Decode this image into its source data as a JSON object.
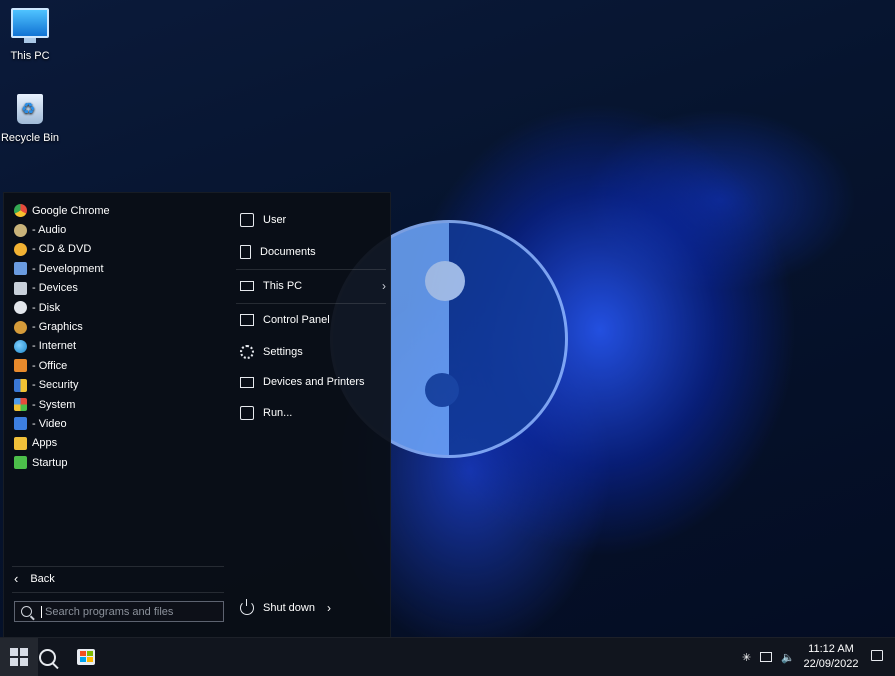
{
  "desktop": {
    "icons": [
      {
        "label": "This PC",
        "icon": "monitor-icon"
      },
      {
        "label": "Recycle Bin",
        "icon": "recycle-bin-icon"
      }
    ]
  },
  "start_menu": {
    "programs": [
      {
        "label": "Google Chrome",
        "icon": "chrome-icon",
        "color": "#e64a3b"
      },
      {
        "label": "- Audio",
        "icon": "audio-icon",
        "color": "#c9b37a"
      },
      {
        "label": "- CD & DVD",
        "icon": "cd-dvd-icon",
        "color": "#f2b233"
      },
      {
        "label": "- Development",
        "icon": "development-icon",
        "color": "#6a9be0"
      },
      {
        "label": "- Devices",
        "icon": "devices-icon",
        "color": "#c8d0da"
      },
      {
        "label": "- Disk",
        "icon": "disk-icon",
        "color": "#e2e6ec"
      },
      {
        "label": "- Graphics",
        "icon": "graphics-icon",
        "color": "#d59b3a"
      },
      {
        "label": "- Internet",
        "icon": "internet-icon",
        "color": "#2fa3e0"
      },
      {
        "label": "- Office",
        "icon": "office-icon",
        "color": "#e88a2c"
      },
      {
        "label": "- Security",
        "icon": "security-icon",
        "color": "#3a78d6"
      },
      {
        "label": "- System",
        "icon": "system-icon",
        "color": "#4f9be8"
      },
      {
        "label": "- Video",
        "icon": "video-icon",
        "color": "#3d7fe0"
      },
      {
        "label": "Apps",
        "icon": "apps-icon",
        "color": "#f0c03a"
      },
      {
        "label": "Startup",
        "icon": "startup-icon",
        "color": "#4cbf4a"
      }
    ],
    "back_label": "Back",
    "search_placeholder": "Search programs and files",
    "places": [
      {
        "label": "User",
        "icon": "user-icon"
      },
      {
        "label": "Documents",
        "icon": "document-icon"
      },
      {
        "label": "This PC",
        "icon": "this-pc-icon",
        "has_submenu": true
      },
      {
        "label": "Control Panel",
        "icon": "control-panel-icon"
      },
      {
        "label": "Settings",
        "icon": "gear-icon"
      },
      {
        "label": "Devices and Printers",
        "icon": "devices-printers-icon"
      },
      {
        "label": "Run...",
        "icon": "run-icon"
      }
    ],
    "shutdown_label": "Shut down"
  },
  "taskbar": {
    "clock_time": "11:12 AM",
    "clock_date": "22/09/2022"
  },
  "theme": {
    "accent": "#1f4fe0",
    "menu_bg": "#0a0e16"
  }
}
